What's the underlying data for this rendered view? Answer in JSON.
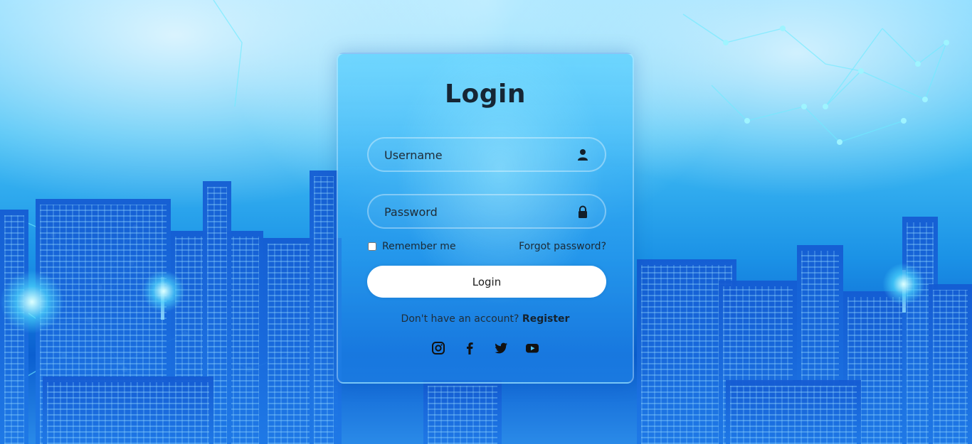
{
  "login_form": {
    "title": "Login",
    "username_placeholder": "Username",
    "password_placeholder": "Password",
    "remember_me_label": "Remember me",
    "forgot_password_label": "Forgot password?",
    "submit_label": "Login",
    "register_prompt": "Don't have an account?",
    "register_link": "Register"
  },
  "icons": {
    "username": "user-icon",
    "password": "lock-icon",
    "social": [
      "instagram-icon",
      "facebook-icon",
      "twitter-icon",
      "youtube-icon"
    ]
  },
  "colors": {
    "title_text": "#162634",
    "button_background": "#ffffff",
    "background_blue": "#1b92e6"
  }
}
